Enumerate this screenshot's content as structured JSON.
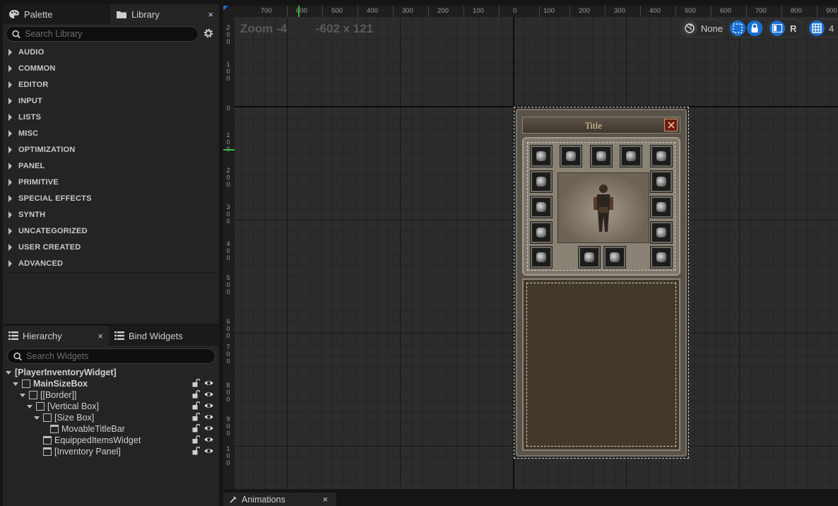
{
  "palette_panel": {
    "tab_palette": "Palette",
    "tab_library": "Library",
    "close": "×",
    "search_placeholder": "Search Library",
    "categories": [
      "AUDIO",
      "COMMON",
      "EDITOR",
      "INPUT",
      "LISTS",
      "MISC",
      "OPTIMIZATION",
      "PANEL",
      "PRIMITIVE",
      "SPECIAL EFFECTS",
      "SYNTH",
      "UNCATEGORIZED",
      "USER CREATED",
      "ADVANCED"
    ]
  },
  "hierarchy_panel": {
    "tab_hierarchy": "Hierarchy",
    "tab_bind": "Bind Widgets",
    "close": "×",
    "search_placeholder": "Search Widgets",
    "items": [
      {
        "label": "[PlayerInventoryWidget]",
        "depth": 0
      },
      {
        "label": "MainSizeBox",
        "depth": 1
      },
      {
        "label": "[[Border]]",
        "depth": 2
      },
      {
        "label": "[Vertical Box]",
        "depth": 3
      },
      {
        "label": "[Size Box]",
        "depth": 4
      },
      {
        "label": "MovableTitleBar",
        "depth": 5
      },
      {
        "label": "EquippedItemsWidget",
        "depth": 4
      },
      {
        "label": "[Inventory Panel]",
        "depth": 4
      }
    ]
  },
  "designer": {
    "zoom": "Zoom -4",
    "size": "-602 x 121",
    "toolbar": {
      "none_label": "None",
      "r_label": "R",
      "grid_value": "4"
    },
    "ruler_h": [
      "700",
      "600",
      "500",
      "400",
      "300",
      "200",
      "100",
      "0",
      "100",
      "200",
      "300",
      "400",
      "500",
      "600",
      "700",
      "800",
      "900"
    ],
    "ruler_v": [
      "200",
      "100",
      "0",
      "100",
      "200",
      "300",
      "400",
      "500",
      "600",
      "700",
      "800",
      "900",
      "100"
    ],
    "widget_title": "Title"
  },
  "bottom": {
    "animations_tab": "Animations",
    "close": "×"
  },
  "colors": {
    "accent_blue": "#1a6fd0",
    "panel": "#242424",
    "canvas": "#2c2c2c"
  }
}
